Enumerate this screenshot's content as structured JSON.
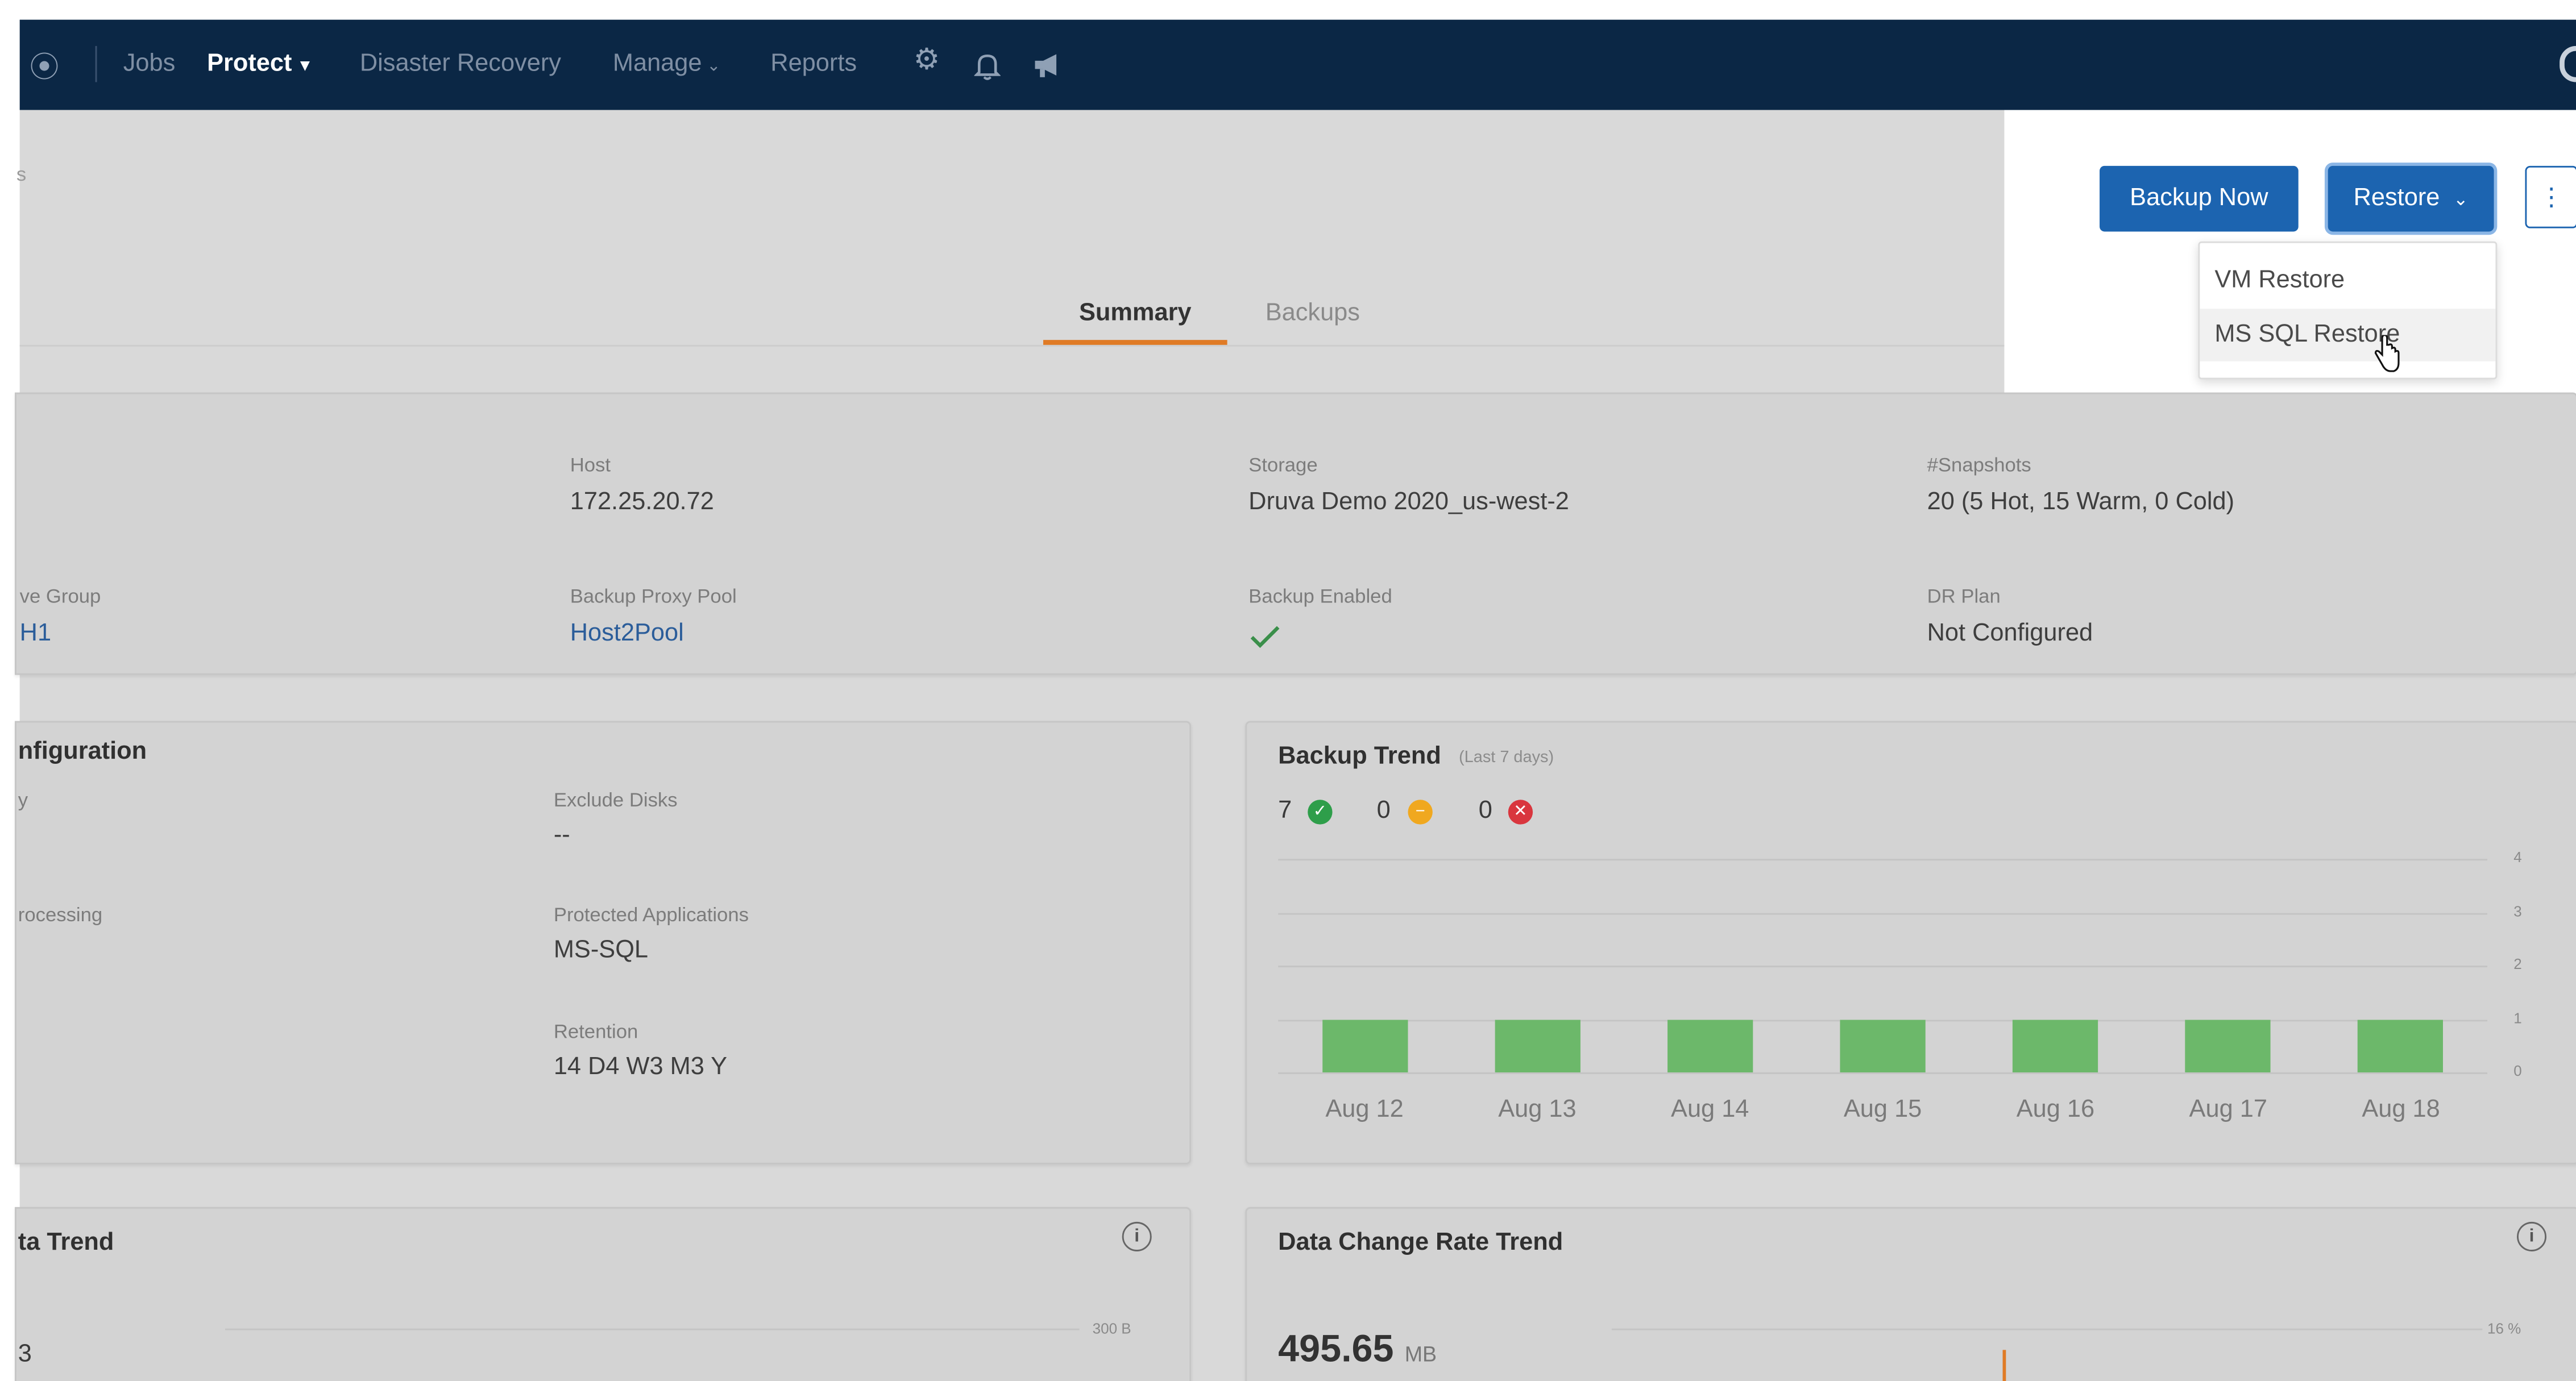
{
  "nav": {
    "items": [
      {
        "label": "Jobs"
      },
      {
        "label": "Protect",
        "active": true,
        "dropdown": true
      },
      {
        "label": "Disaster Recovery"
      },
      {
        "label": "Manage",
        "dropdown": true
      },
      {
        "label": "Reports"
      }
    ],
    "icons": [
      "settings-gear-icon",
      "notification-bell-icon",
      "announcement-megaphone-icon"
    ]
  },
  "header": {
    "breadcrumb_fragment": "s",
    "backup_now_label": "Backup Now",
    "restore_label": "Restore",
    "more_icon": "vertical-ellipsis-icon",
    "restore_menu": [
      "VM Restore",
      "MS SQL Restore"
    ]
  },
  "tabs": [
    {
      "label": "Summary",
      "active": true
    },
    {
      "label": "Backups",
      "active": false
    }
  ],
  "details": {
    "host_label": "Host",
    "host_value": "172.25.20.72",
    "storage_label": "Storage",
    "storage_value": "Druva Demo 2020_us-west-2",
    "snapshots_label": "#Snapshots",
    "snapshots_value": "20 (5 Hot, 15 Warm, 0 Cold)",
    "group_label": "ve Group",
    "group_value": "H1",
    "proxy_label": "Backup Proxy Pool",
    "proxy_value": "Host2Pool",
    "backup_enabled_label": "Backup Enabled",
    "backup_enabled_icon": "check-icon",
    "dr_label": "DR Plan",
    "dr_value": "Not Configured"
  },
  "configuration": {
    "title": "nfiguration",
    "left_label_1": "y",
    "left_label_2": "rocessing",
    "exclude_label": "Exclude Disks",
    "exclude_value": "--",
    "apps_label": "Protected Applications",
    "apps_value": "MS-SQL",
    "retention_label": "Retention",
    "retention_value": "14 D4 W3 M3 Y"
  },
  "backup_trend": {
    "title": "Backup Trend",
    "subtitle": "(Last 7 days)",
    "counts": [
      {
        "value": "7",
        "status": "success",
        "color": "#2e9e4a"
      },
      {
        "value": "0",
        "status": "warning",
        "color": "#f0a81f"
      },
      {
        "value": "0",
        "status": "failed",
        "color": "#d9363e"
      }
    ]
  },
  "chart_data": {
    "type": "bar",
    "title": "Backup Trend",
    "categories": [
      "Aug 12",
      "Aug 13",
      "Aug 14",
      "Aug 15",
      "Aug 16",
      "Aug 17",
      "Aug 18"
    ],
    "values": [
      1,
      1,
      1,
      1,
      1,
      1,
      1
    ],
    "ylim": [
      0,
      4
    ],
    "yticks": [
      "0",
      "1",
      "2",
      "3",
      "4"
    ],
    "bar_color": "#6cb86a",
    "grid": true
  },
  "data_trend": {
    "title": "ta Trend",
    "left_value": "3",
    "axis_label": "300 B",
    "info_icon": "info-icon"
  },
  "change_rate": {
    "title": "Data Change Rate Trend",
    "value": "495.65",
    "unit": "MB",
    "axis_label": "16 %",
    "info_icon": "info-icon"
  }
}
